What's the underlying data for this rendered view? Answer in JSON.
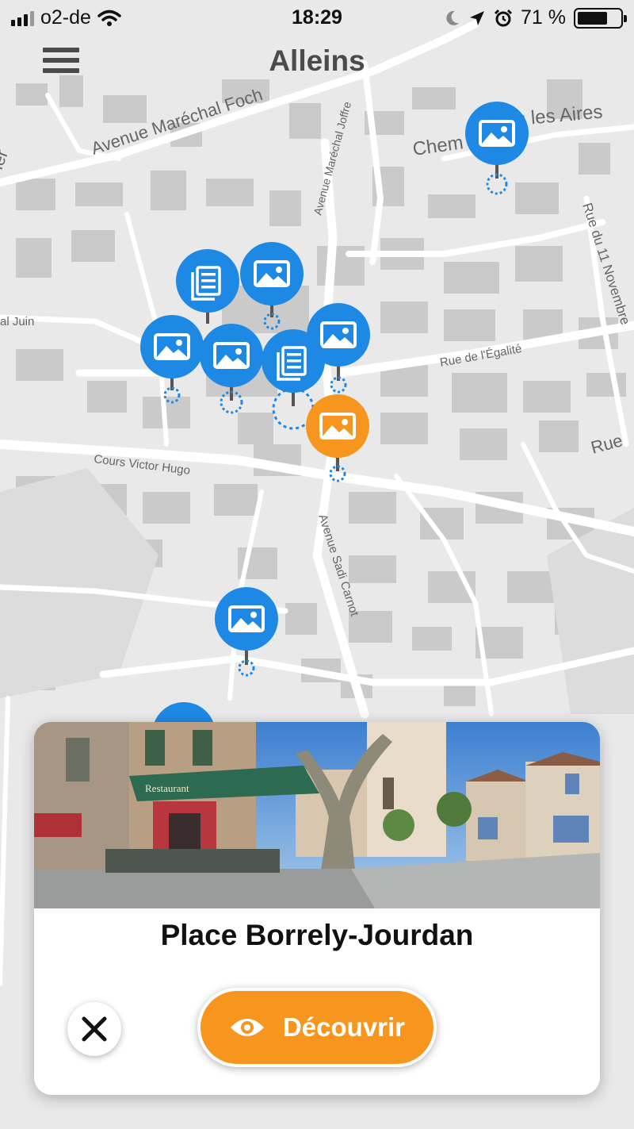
{
  "status_bar": {
    "carrier": "o2-de",
    "time": "18:29",
    "battery_percent": "71 %",
    "battery_level": 0.71,
    "icons": [
      "signal-icon",
      "wifi-icon",
      "moon-icon",
      "location-arrow-icon",
      "alarm-icon",
      "battery-icon"
    ]
  },
  "header": {
    "title": "Alleins",
    "menu_icon": "hamburger-menu-icon"
  },
  "map": {
    "street_labels": [
      "Avenue Maréchal Foch",
      "Avenue Maréchal Joffre",
      "Chem",
      "s les Aires",
      "Rue du 11 Novembre",
      "Rue de l'Égalité",
      "Rue",
      "Cours Victor Hugo",
      "Avenue Sadi Carnot",
      "al Juin",
      "ier"
    ],
    "markers": [
      {
        "icon": "image-icon",
        "state": "default"
      },
      {
        "icon": "article-icon",
        "state": "default"
      },
      {
        "icon": "image-icon",
        "state": "default"
      },
      {
        "icon": "image-icon",
        "state": "default"
      },
      {
        "icon": "image-icon",
        "state": "default"
      },
      {
        "icon": "article-icon",
        "state": "default"
      },
      {
        "icon": "image-icon",
        "state": "default"
      },
      {
        "icon": "image-icon",
        "state": "selected"
      },
      {
        "icon": "image-icon",
        "state": "default"
      },
      {
        "icon": "image-icon",
        "state": "default"
      }
    ],
    "colors": {
      "marker_default": "#1e88e5",
      "marker_selected": "#f7961e",
      "map_background": "#e9e9e9",
      "road": "#ffffff",
      "building": "#c9c9c9"
    }
  },
  "place_card": {
    "title": "Place Borrely-Jourdan",
    "photo_sign": "Restaurant",
    "close_icon": "close-icon",
    "discover_label": "Découvrir",
    "discover_icon": "eye-icon",
    "accent": "#f7961e"
  }
}
